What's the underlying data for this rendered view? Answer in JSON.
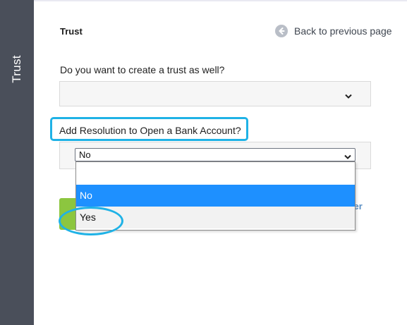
{
  "sidebar": {
    "label": "Trust"
  },
  "header": {
    "title": "Trust",
    "back_link": "Back to previous page",
    "back_icon": "arrow-left-circle-icon"
  },
  "questions": {
    "create_trust": {
      "label": "Do you want to create a trust as well?",
      "value": ""
    },
    "resolution": {
      "label": "Add Resolution to Open a Bank Account?",
      "value": "No",
      "options": [
        "",
        "No",
        "Yes"
      ],
      "highlighted_option": "No"
    }
  },
  "actions": {
    "later_partial": "ater"
  },
  "colors": {
    "sidebar_bg": "#4a4f5a",
    "highlight_callout": "#1fb2e6",
    "selected_option": "#1e90ff",
    "primary_button": "#8cc63f",
    "link": "#5a8fc4"
  }
}
